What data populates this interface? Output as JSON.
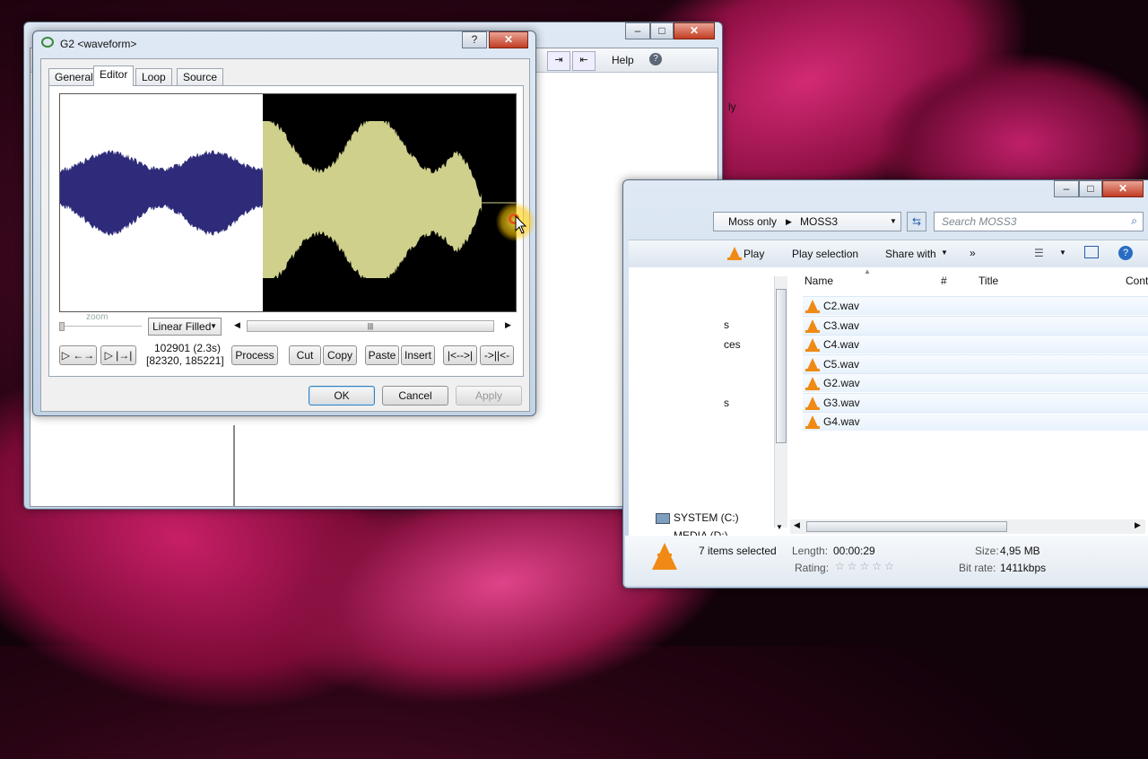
{
  "desktop": {
    "accent": "#a3124f"
  },
  "back_window": {
    "menu": {
      "help_label": "Help",
      "help_icon": "?"
    },
    "partial_text": "ly"
  },
  "explorer": {
    "breadcrumb": {
      "items": [
        "Moss only",
        "MOSS3"
      ]
    },
    "search_placeholder": "Search MOSS3",
    "toolbar": {
      "play": "Play",
      "play_selection": "Play selection",
      "share_with": "Share with",
      "more": "»"
    },
    "columns": {
      "name": "Name",
      "number": "#",
      "title": "Title",
      "cont": "Cont"
    },
    "files": [
      "C2.wav",
      "C3.wav",
      "C4.wav",
      "C5.wav",
      "G2.wav",
      "G3.wav",
      "G4.wav"
    ],
    "nav": {
      "drive_c": "SYSTEM (C:)",
      "drive_d": "MEDIA (D:)",
      "frag1": "s",
      "frag2": "ces",
      "frag3": "s"
    },
    "details": {
      "selected": "7 items selected",
      "length_label": "Length:",
      "length_value": "00:00:29",
      "rating_label": "Rating:",
      "size_label": "Size:",
      "size_value": "4,95 MB",
      "bitrate_label": "Bit rate:",
      "bitrate_value": "1411kbps"
    }
  },
  "dialog": {
    "title": "G2 <waveform>",
    "help_btn": "?",
    "close_btn": "✕",
    "tabs": [
      "General",
      "Editor",
      "Loop",
      "Source"
    ],
    "active_tab": "Editor",
    "zoom_label": "zoom",
    "view_mode": "Linear Filled",
    "position_line1": "102901 (2.3s)",
    "position_line2": "[82320, 185221]",
    "buttons": {
      "play_loop": "▷ ←→",
      "play_range": "▷ |→|",
      "process": "Process",
      "cut": "Cut",
      "copy": "Copy",
      "paste": "Paste",
      "insert": "Insert",
      "trim_left": "|<-->|",
      "trim_right": "->||<-",
      "ok": "OK",
      "cancel": "Cancel",
      "apply": "Apply"
    },
    "colors": {
      "selection": "#2e2b7a",
      "waveform_selected_bg": "#ffffff",
      "waveform_fill": "#cfd08c",
      "waveform_bg": "#000000"
    }
  }
}
